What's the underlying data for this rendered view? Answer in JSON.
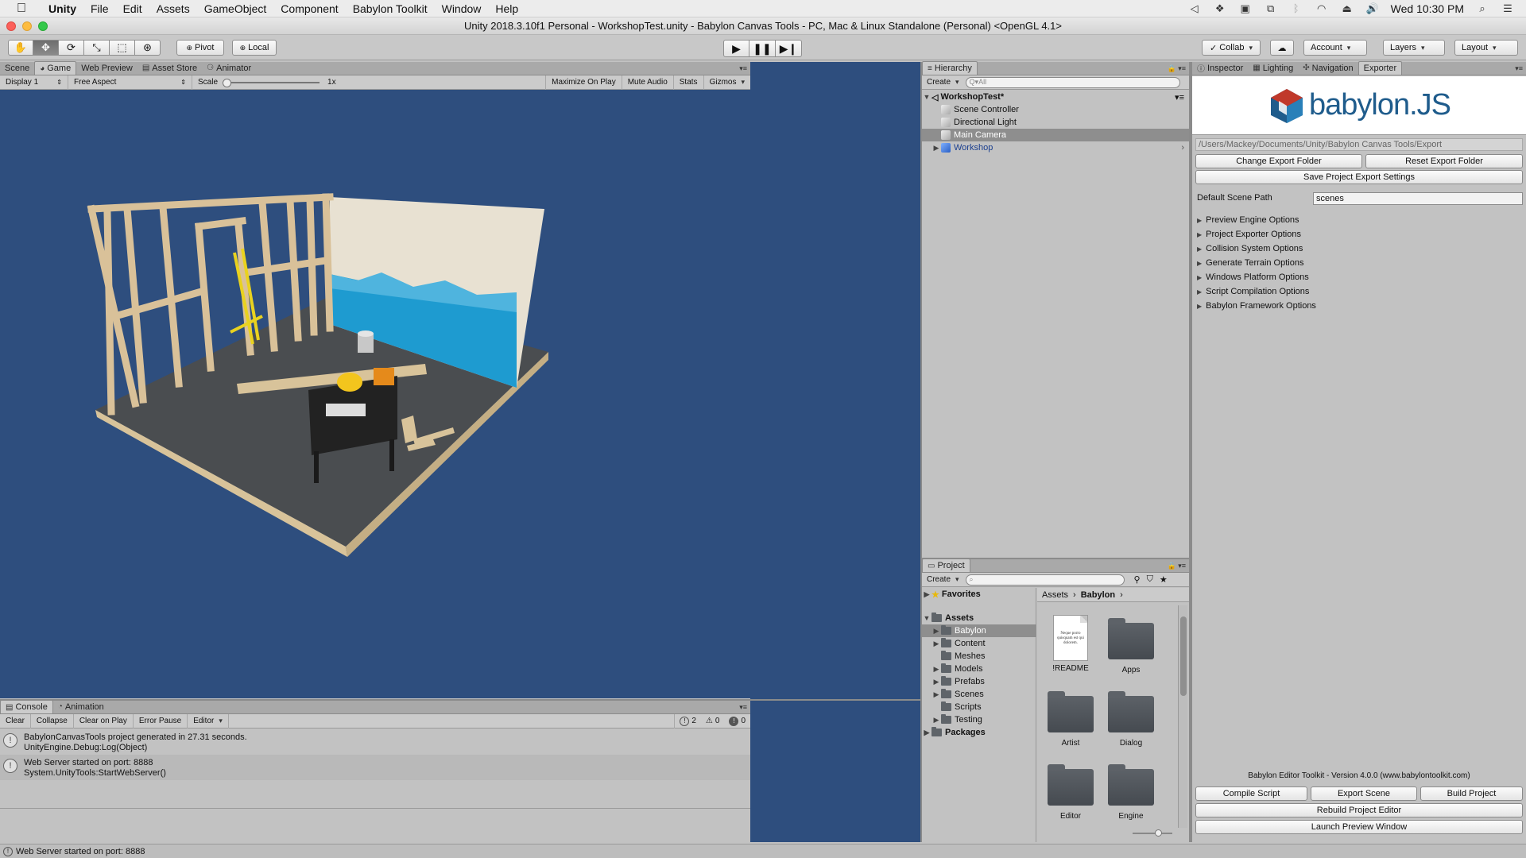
{
  "menubar": {
    "items": [
      "Unity",
      "File",
      "Edit",
      "Assets",
      "GameObject",
      "Component",
      "Babylon Toolkit",
      "Window",
      "Help"
    ],
    "clock": "Wed 10:30 PM"
  },
  "window": {
    "title": "Unity 2018.3.10f1 Personal - WorkshopTest.unity - Babylon Canvas Tools - PC, Mac & Linux Standalone (Personal) <OpenGL 4.1>"
  },
  "toolbar": {
    "pivot": "Pivot",
    "local": "Local",
    "collab": "Collab",
    "account": "Account",
    "layers": "Layers",
    "layout": "Layout"
  },
  "game": {
    "tabs": [
      "Scene",
      "Game",
      "Web Preview",
      "Asset Store",
      "Animator"
    ],
    "display": "Display 1",
    "aspect": "Free Aspect",
    "scale_label": "Scale",
    "scale_value": "1x",
    "buttons": [
      "Maximize On Play",
      "Mute Audio",
      "Stats",
      "Gizmos"
    ]
  },
  "console": {
    "tabs": [
      "Console",
      "Animation"
    ],
    "buttons": [
      "Clear",
      "Collapse",
      "Clear on Play",
      "Error Pause",
      "Editor"
    ],
    "counts": {
      "info": "2",
      "warn": "0",
      "error": "0"
    },
    "logs": [
      {
        "line1": "BabylonCanvasTools project generated in 27.31 seconds.",
        "line2": "UnityEngine.Debug:Log(Object)"
      },
      {
        "line1": "Web Server started on port: 8888",
        "line2": "System.UnityTools:StartWebServer()"
      }
    ]
  },
  "status": {
    "message": "Web Server started on port: 8888"
  },
  "hierarchy": {
    "tab": "Hierarchy",
    "create": "Create",
    "search_placeholder": "Q▾All",
    "scene": "WorkshopTest*",
    "items": [
      "Scene Controller",
      "Directional Light",
      "Main Camera",
      "Workshop"
    ]
  },
  "project": {
    "tab": "Project",
    "create": "Create",
    "favorites": "Favorites",
    "assets": "Assets",
    "folders": [
      "Babylon",
      "Content",
      "Meshes",
      "Models",
      "Prefabs",
      "Scenes",
      "Scripts",
      "Testing"
    ],
    "packages": "Packages",
    "breadcrumb": [
      "Assets",
      "Babylon"
    ],
    "files": [
      "!README",
      "Apps",
      "Artist",
      "Dialog",
      "Editor",
      "Engine"
    ],
    "readme_preview": "Neque porro quisquam est qui dolorem."
  },
  "inspector": {
    "tabs": [
      "Inspector",
      "Lighting",
      "Navigation",
      "Exporter"
    ],
    "logo_text": "babylon.JS",
    "export_path": "/Users/Mackey/Documents/Unity/Babylon Canvas Tools/Export",
    "change_export": "Change Export Folder",
    "reset_export": "Reset Export Folder",
    "save_settings": "Save Project Export Settings",
    "scene_path_label": "Default Scene Path",
    "scene_path_value": "scenes",
    "options": [
      "Preview Engine Options",
      "Project Exporter Options",
      "Collision System Options",
      "Generate Terrain Options",
      "Windows Platform Options",
      "Script Compilation Options",
      "Babylon Framework Options"
    ],
    "version": "Babylon Editor Toolkit - Version 4.0.0 (www.babylontoolkit.com)",
    "compile": "Compile Script",
    "export_scene": "Export Scene",
    "build": "Build Project",
    "rebuild": "Rebuild Project Editor",
    "launch": "Launch Preview Window"
  },
  "colors": {
    "game_background": "#2e4e7e",
    "selection": "#8e8e8e",
    "babylon_blue": "#1f5c8c",
    "babylon_red": "#c0392b"
  }
}
